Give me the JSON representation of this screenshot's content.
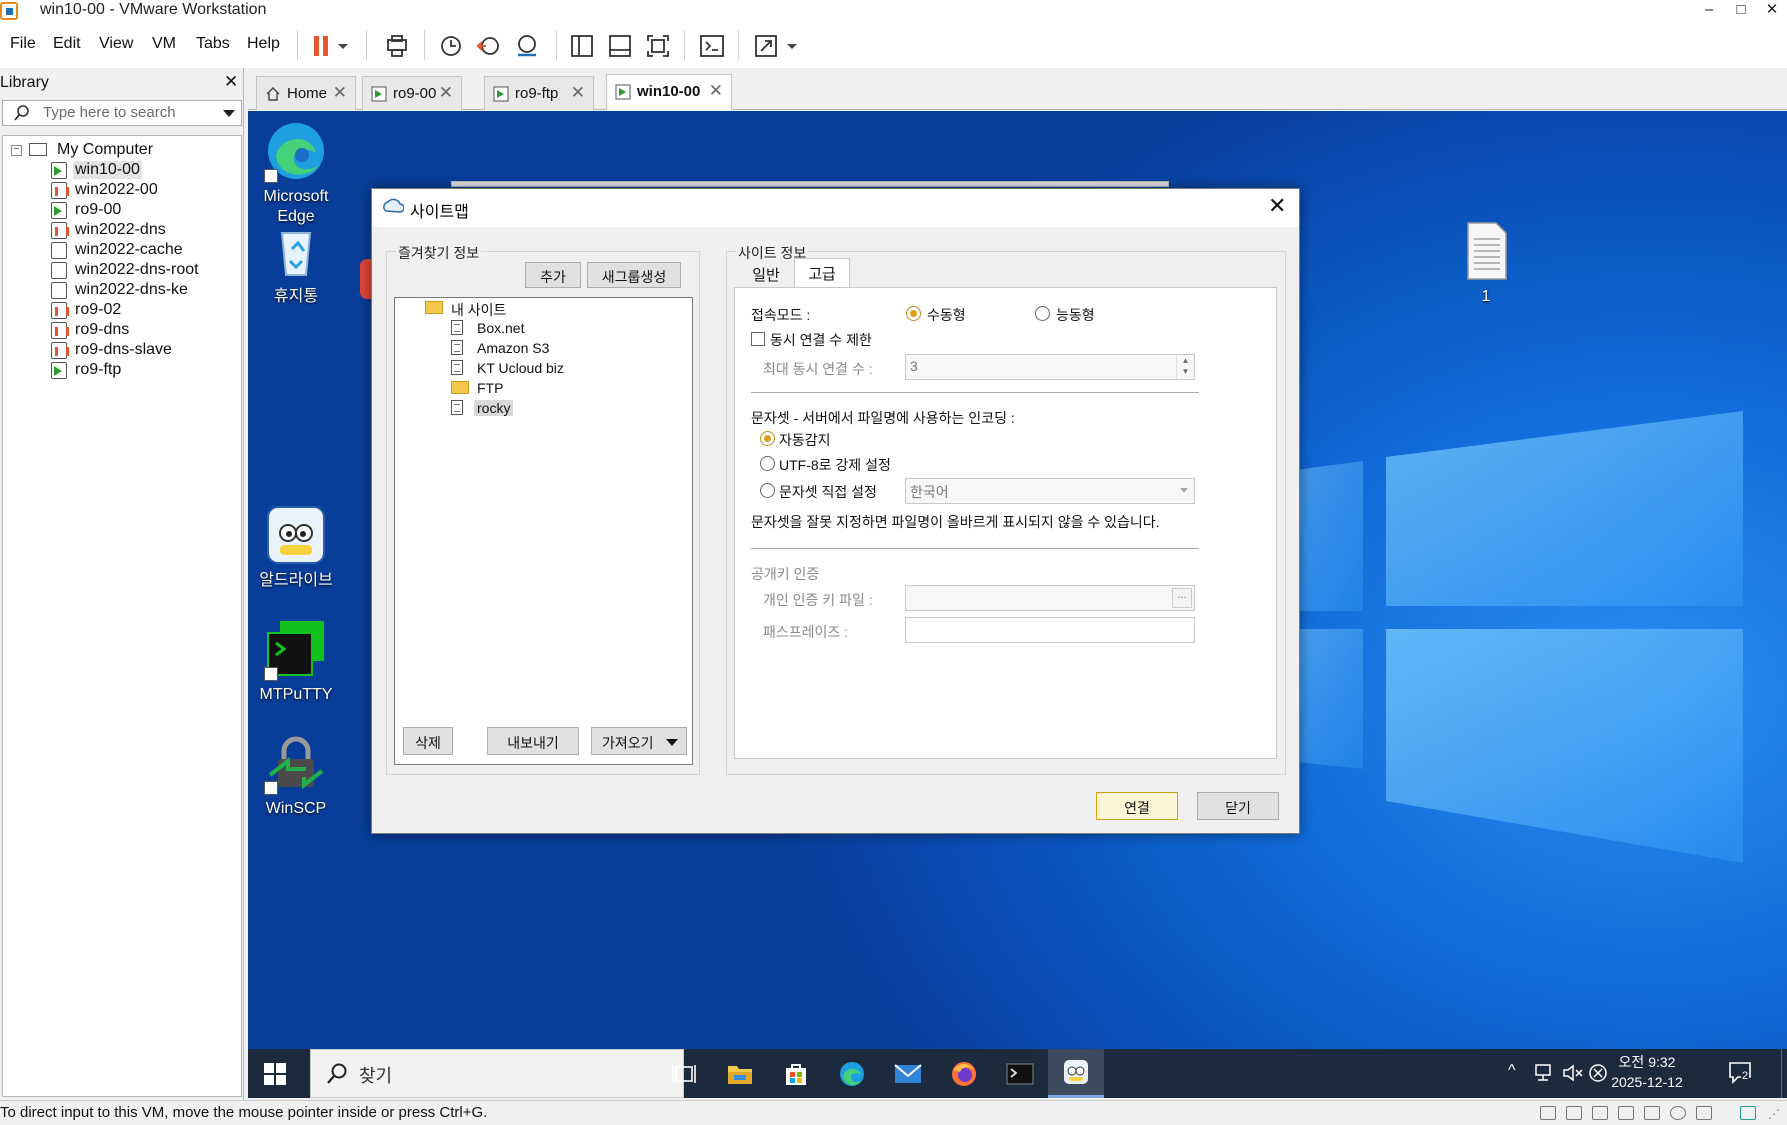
{
  "window": {
    "title": "win10-00 - VMware Workstation",
    "minimize": "–",
    "maximize": "□",
    "close": "✕"
  },
  "menu": {
    "items": [
      "File",
      "Edit",
      "View",
      "VM",
      "Tabs",
      "Help"
    ]
  },
  "toolbar": {
    "icons": [
      "pause-icon",
      "dropdown-arrow-icon",
      "send-keys-icon",
      "snapshot-icon",
      "revert-snapshot-icon",
      "snapshot-manager-icon",
      "library-view-icon",
      "thumbnail-view-icon",
      "full-screen-icon",
      "console-icon",
      "stretch-icon"
    ]
  },
  "library": {
    "title": "Library",
    "close": "✕",
    "search_placeholder": "Type here to search",
    "root": "My Computer",
    "vms": [
      {
        "name": "win10-00",
        "state": "running",
        "selected": true
      },
      {
        "name": "win2022-00",
        "state": "suspended"
      },
      {
        "name": "ro9-00",
        "state": "running"
      },
      {
        "name": "win2022-dns",
        "state": "suspended"
      },
      {
        "name": "win2022-cache",
        "state": "off"
      },
      {
        "name": "win2022-dns-root",
        "state": "off"
      },
      {
        "name": "win2022-dns-ke",
        "state": "off"
      },
      {
        "name": "ro9-02",
        "state": "suspended"
      },
      {
        "name": "ro9-dns",
        "state": "suspended"
      },
      {
        "name": "ro9-dns-slave",
        "state": "suspended"
      },
      {
        "name": "ro9-ftp",
        "state": "running"
      }
    ]
  },
  "tabs": [
    {
      "label": "Home",
      "active": false
    },
    {
      "label": "ro9-00",
      "active": false
    },
    {
      "label": "ro9-ftp",
      "active": false
    },
    {
      "label": "win10-00",
      "active": true
    }
  ],
  "desktop": {
    "icons": [
      {
        "label_line1": "Microsoft",
        "label_line2": "Edge"
      },
      {
        "label_line1": "휴지통",
        "label_line2": ""
      },
      {
        "label_line1": "알드라이브",
        "label_line2": ""
      },
      {
        "label_line1": "MTPuTTY",
        "label_line2": ""
      },
      {
        "label_line1": "WinSCP",
        "label_line2": ""
      },
      {
        "label_line1": "1",
        "label_line2": ""
      }
    ]
  },
  "dialog": {
    "title": "사이트맵",
    "close": "✕",
    "favorites": {
      "group_title": "즐겨찾기 정보",
      "add_button": "추가",
      "new_group_button": "새그룹생성",
      "tree": [
        {
          "label": "내 사이트",
          "type": "folder",
          "level": 0
        },
        {
          "label": "Box.net",
          "type": "site",
          "level": 1
        },
        {
          "label": "Amazon S3",
          "type": "site",
          "level": 1
        },
        {
          "label": "KT Ucloud biz",
          "type": "site",
          "level": 1
        },
        {
          "label": "FTP",
          "type": "folder",
          "level": 1
        },
        {
          "label": "rocky",
          "type": "site",
          "level": 1,
          "selected": true
        }
      ],
      "delete_button": "삭제",
      "export_button": "내보내기",
      "import_button": "가져오기"
    },
    "site_info": {
      "group_title": "사이트 정보",
      "tabs": [
        {
          "label": "일반",
          "active": false
        },
        {
          "label": "고급",
          "active": true
        }
      ],
      "connection_mode_label": "접속모드 :",
      "mode_passive": "수동형",
      "mode_active": "능동형",
      "mode_selected": "수동형",
      "limit_connections_label": "동시 연결 수 제한",
      "max_connections_label": "최대 동시 연결 수 :",
      "max_connections_value": "3",
      "charset_label": "문자셋 - 서버에서 파일명에 사용하는 인코딩 :",
      "charset_auto": "자동감지",
      "charset_utf8": "UTF-8로 강제 설정",
      "charset_manual": "문자셋 직접 설정",
      "charset_selected": "자동감지",
      "charset_value": "한국어",
      "charset_warning": "문자셋을 잘못 지정하면 파일명이 올바르게 표시되지 않을 수 있습니다.",
      "pubkey_title": "공개키 인증",
      "private_key_label": "개인 인증 키 파일 :",
      "private_key_value": "",
      "browse_button": "...",
      "passphrase_label": "패스프레이즈 :",
      "passphrase_value": ""
    },
    "connect_button": "연결",
    "close_button": "닫기"
  },
  "taskbar": {
    "search_placeholder": "찾기",
    "clock_time": "오전 9:32",
    "clock_date": "2025-12-12",
    "notification_count": "2"
  },
  "status": {
    "text": "To direct input to this VM, move the mouse pointer inside or press Ctrl+G."
  }
}
